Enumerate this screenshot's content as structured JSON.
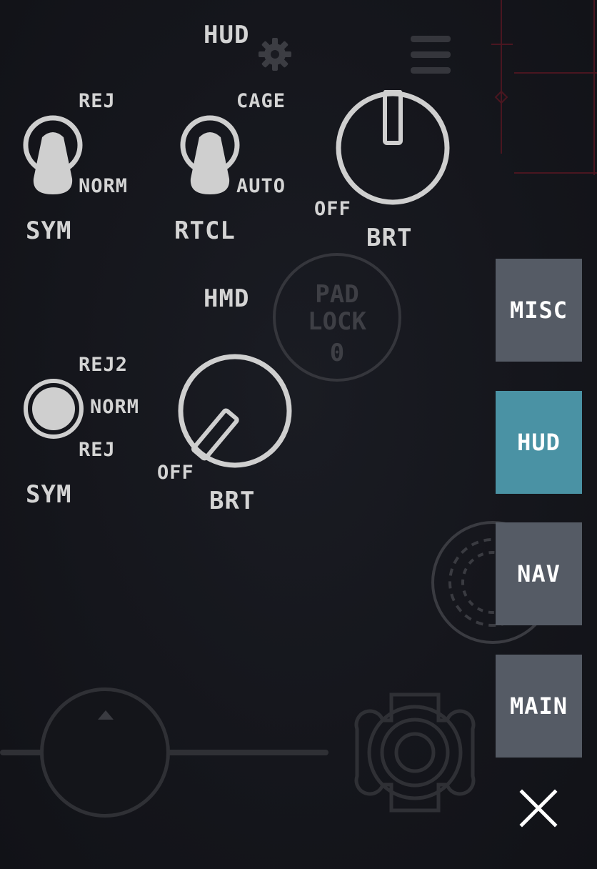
{
  "hud": {
    "title": "HUD",
    "sym": {
      "label": "SYM",
      "top": "REJ",
      "bottom": "NORM",
      "position": "NORM"
    },
    "rtcl": {
      "label": "RTCL",
      "top": "CAGE",
      "bottom": "AUTO",
      "position": "AUTO"
    },
    "brt": {
      "off_label": "OFF",
      "label": "BRT",
      "level": 1.0
    }
  },
  "hmd": {
    "title": "HMD",
    "sym": {
      "label": "SYM",
      "top": "REJ2",
      "middle": "NORM",
      "bottom": "REJ",
      "position": "NORM"
    },
    "brt": {
      "off_label": "OFF",
      "label": "BRT",
      "level": 0.15
    }
  },
  "background": {
    "padlock_line1": "PAD",
    "padlock_line2": "LOCK",
    "padlock_line3": "0"
  },
  "side_menu": [
    {
      "label": "MISC",
      "active": false
    },
    {
      "label": "HUD",
      "active": true
    },
    {
      "label": "NAV",
      "active": false
    },
    {
      "label": "MAIN",
      "active": false
    }
  ],
  "colors": {
    "active_tab": "#4a92a4",
    "inactive_tab": "#555b65",
    "control_gray": "#cfcfcf",
    "background": "#15161c",
    "hud_red": "#5a1a24"
  },
  "icons": {
    "settings": "gear-icon",
    "menu": "hamburger-icon",
    "close": "close-icon"
  }
}
